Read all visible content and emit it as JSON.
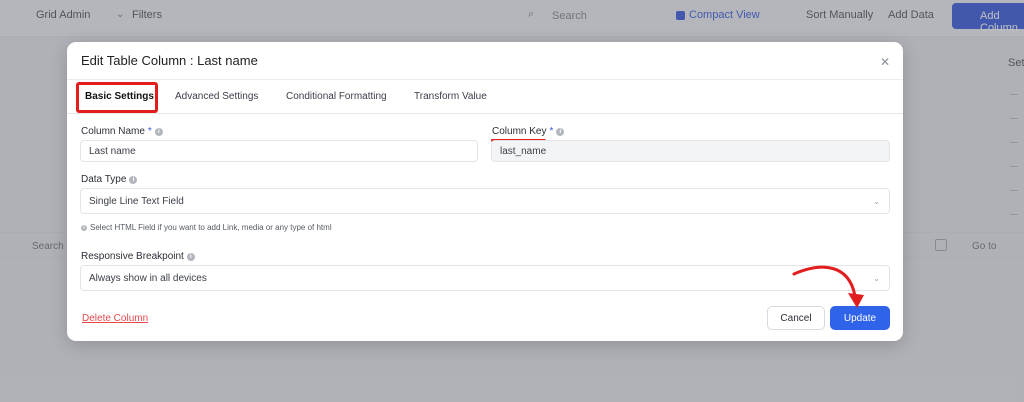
{
  "background": {
    "app_name": "Grid Admin",
    "filter_label": "Filters",
    "search_placeholder": "Search",
    "compact_label": "Compact View",
    "link1": "Sort Manually",
    "link2": "Add Data",
    "add_button": "Add Column",
    "right_label": "Set",
    "bottom_left": "Search",
    "bottom_right": "Go to"
  },
  "modal": {
    "title": "Edit Table Column : Last name",
    "close_icon": "close-icon",
    "tabs": [
      {
        "label": "Basic Settings",
        "active": true
      },
      {
        "label": "Advanced Settings"
      },
      {
        "label": "Conditional Formatting"
      },
      {
        "label": "Transform Value"
      }
    ],
    "column_name": {
      "label": "Column Name",
      "required": "*",
      "value": "Last name"
    },
    "column_key": {
      "label": "Column Key",
      "required": "*",
      "value": "last_name"
    },
    "data_type": {
      "label": "Data Type",
      "value": "Single Line Text Field",
      "hint": "Select HTML Field if you want to add Link, media or any type of html"
    },
    "responsive": {
      "label": "Responsive Breakpoint",
      "value": "Always show in all devices"
    },
    "delete_label": "Delete Column",
    "cancel_label": "Cancel",
    "update_label": "Update"
  },
  "colors": {
    "accent": "#2f63ea",
    "annotation_red": "#e11d1d",
    "delete_red": "#e5484d"
  }
}
